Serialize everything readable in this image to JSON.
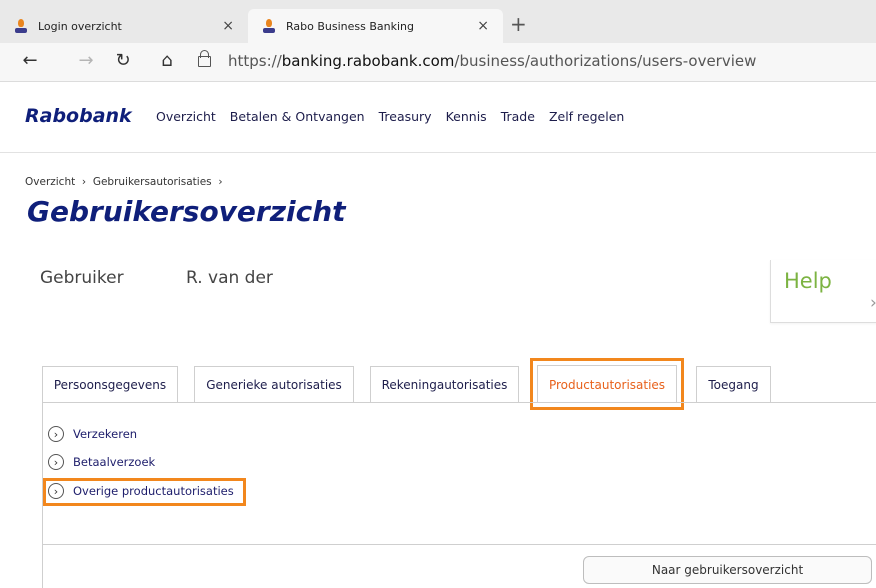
{
  "browser": {
    "tabs": [
      {
        "title": "Login overzicht",
        "close": "×"
      },
      {
        "title": "Rabo Business Banking",
        "close": "×"
      }
    ],
    "new_tab": "+",
    "nav": {
      "back": "←",
      "forward": "→",
      "refresh": "↻",
      "home": "⌂"
    },
    "url": {
      "scheme": "https://",
      "domain": "banking.rabobank.com",
      "path": "/business/authorizations/users-overview"
    }
  },
  "site": {
    "logo": "Rabobank",
    "nav": [
      "Overzicht",
      "Betalen & Ontvangen",
      "Treasury",
      "Kennis",
      "Trade",
      "Zelf regelen"
    ]
  },
  "breadcrumb": {
    "items": [
      "Overzicht",
      "Gebruikersautorisaties"
    ],
    "separator": "›"
  },
  "page_title": "Gebruikersoverzicht",
  "user": {
    "label": "Gebruiker",
    "value": "R. van der"
  },
  "help": {
    "label": "Help",
    "chevron": "›"
  },
  "tabs": [
    {
      "label": "Persoonsgegevens"
    },
    {
      "label": "Generieke autorisaties"
    },
    {
      "label": "Rekeningautorisaties"
    },
    {
      "label": "Productautorisaties",
      "active": true
    },
    {
      "label": "Toegang"
    }
  ],
  "items": [
    {
      "label": "Verzekeren"
    },
    {
      "label": "Betaalverzoek"
    },
    {
      "label": "Overige productautorisaties"
    }
  ],
  "chevron": "›",
  "back_button": "Naar gebruikersoverzicht",
  "colors": {
    "brand": "#0f1f7a",
    "active_tab": "#e8611b",
    "highlight": "#f2871d",
    "help": "#7cb342"
  }
}
